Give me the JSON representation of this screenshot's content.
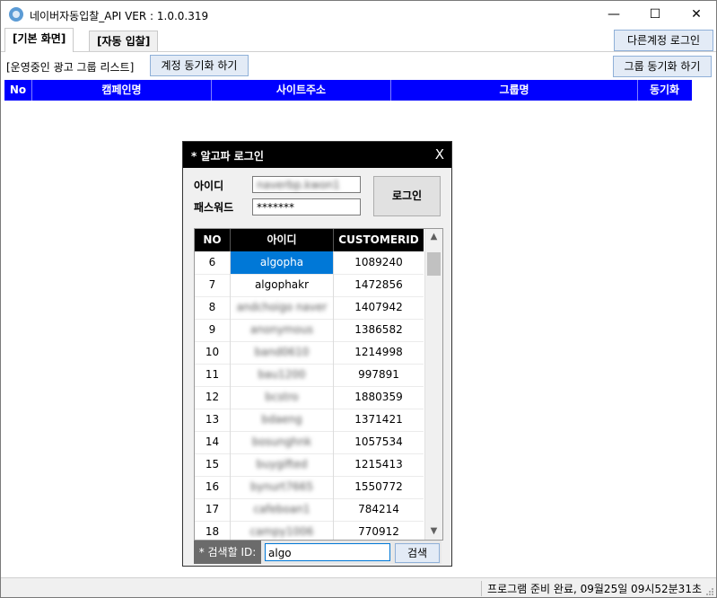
{
  "window": {
    "title": "네이버자동입찰_API VER : 1.0.0.319",
    "minimize": "—",
    "maximize": "☐",
    "close": "✕"
  },
  "tabs": [
    {
      "label": "[기본 화면]",
      "active": true
    },
    {
      "label": "[자동 입찰]",
      "active": false
    }
  ],
  "toolbar": {
    "other_login": "다른계정 로그인",
    "section_label": "[운영중인 광고 그룹 리스트]",
    "account_sync": "계정 동기화 하기",
    "group_sync": "그룹 동기화 하기"
  },
  "grid": {
    "columns": [
      "No",
      "캠페인명",
      "사이트주소",
      "그룹명",
      "동기화"
    ]
  },
  "status": {
    "text": "프로그램 준비 완료, 09월25일 09시52분31초"
  },
  "login_dialog": {
    "title": "* 알고파 로그인",
    "close": "X",
    "id_label": "아이디",
    "id_value": "naverbp.kwon1",
    "pw_label": "패스워드",
    "pw_value": "*******",
    "login_button": "로그인",
    "table_headers": [
      "NO",
      "아이디",
      "CUSTOMERID"
    ],
    "rows": [
      {
        "no": "6",
        "id": "algopha",
        "cid": "1089240",
        "selected": true,
        "blur": false
      },
      {
        "no": "7",
        "id": "algophakr",
        "cid": "1472856",
        "selected": false,
        "blur": false
      },
      {
        "no": "8",
        "id": "andchoigo naver",
        "cid": "1407942",
        "selected": false,
        "blur": true
      },
      {
        "no": "9",
        "id": "anonymous",
        "cid": "1386582",
        "selected": false,
        "blur": true
      },
      {
        "no": "10",
        "id": "band0610",
        "cid": "1214998",
        "selected": false,
        "blur": true
      },
      {
        "no": "11",
        "id": "bau1200",
        "cid": "997891",
        "selected": false,
        "blur": true
      },
      {
        "no": "12",
        "id": "bcstro",
        "cid": "1880359",
        "selected": false,
        "blur": true
      },
      {
        "no": "13",
        "id": "bdaeng",
        "cid": "1371421",
        "selected": false,
        "blur": true
      },
      {
        "no": "14",
        "id": "bosunghnk",
        "cid": "1057534",
        "selected": false,
        "blur": true
      },
      {
        "no": "15",
        "id": "buygifted",
        "cid": "1215413",
        "selected": false,
        "blur": true
      },
      {
        "no": "16",
        "id": "bynurt7665",
        "cid": "1550772",
        "selected": false,
        "blur": true
      },
      {
        "no": "17",
        "id": "cafeboan1",
        "cid": "784214",
        "selected": false,
        "blur": true
      },
      {
        "no": "18",
        "id": "campy1006",
        "cid": "770912",
        "selected": false,
        "blur": true
      }
    ],
    "search_label": "* 검색할 ID:",
    "search_value": "algo",
    "search_button": "검색",
    "scroll_up": "▲",
    "scroll_down": "▼"
  }
}
